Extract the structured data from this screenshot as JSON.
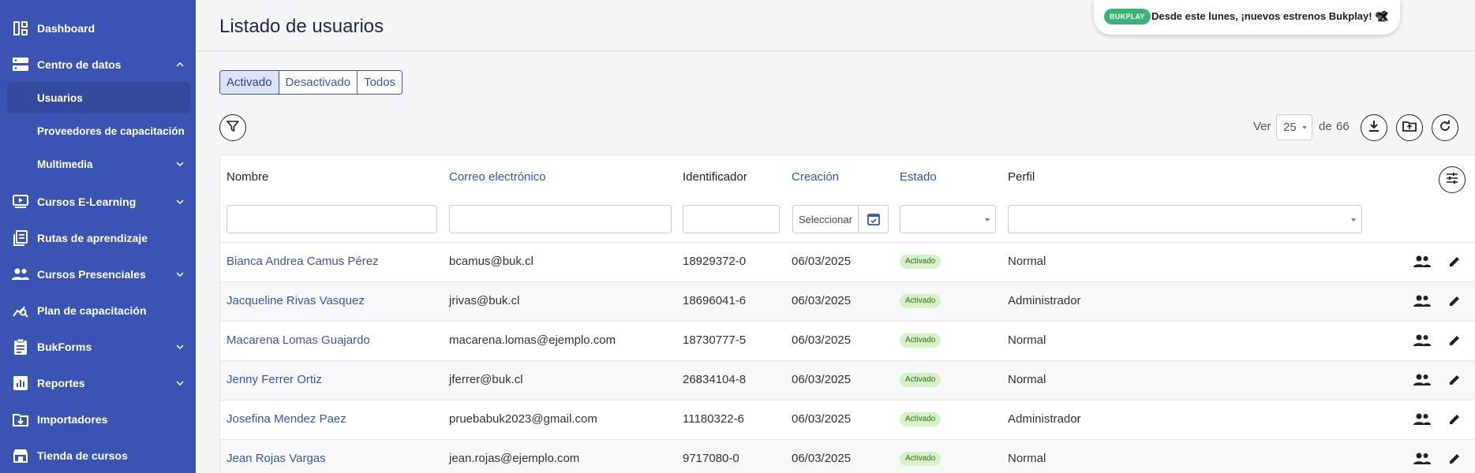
{
  "sidebar": {
    "items": [
      {
        "label": "Dashboard",
        "icon": "dashboard-icon"
      },
      {
        "label": "Centro de datos",
        "icon": "database-icon"
      },
      {
        "label": "Usuarios"
      },
      {
        "label": "Proveedores de capacitación"
      },
      {
        "label": "Multimedia"
      },
      {
        "label": "Cursos E-Learning",
        "icon": "video-course-icon"
      },
      {
        "label": "Rutas de aprendizaje",
        "icon": "learning-path-icon"
      },
      {
        "label": "Cursos Presenciales",
        "icon": "people-icon"
      },
      {
        "label": "Plan de capacitación",
        "icon": "analytics-icon"
      },
      {
        "label": "BukForms",
        "icon": "clipboard-icon"
      },
      {
        "label": "Reportes",
        "icon": "report-icon"
      },
      {
        "label": "Importadores",
        "icon": "import-icon"
      },
      {
        "label": "Tienda de cursos",
        "icon": "store-icon"
      }
    ]
  },
  "header": {
    "title": "Listado de usuarios"
  },
  "toast": {
    "badge": "BUKPLAY",
    "message": "Desde este lunes, ¡nuevos estrenos Bukplay! 📽"
  },
  "tabs": [
    "Activado",
    "Desactivado",
    "Todos"
  ],
  "pagination": {
    "ver_label": "Ver",
    "per_page": "25",
    "de_label": "de",
    "total": "66"
  },
  "table": {
    "columns": {
      "nombre": "Nombre",
      "correo": "Correo electrónico",
      "identificador": "Identificador",
      "creacion": "Creación",
      "estado": "Estado",
      "perfil": "Perfil"
    },
    "date_placeholder": "Seleccionar",
    "rows": [
      {
        "nombre": "Bianca Andrea Camus Pérez",
        "correo": "bcamus@buk.cl",
        "id": "18929372-0",
        "creacion": "06/03/2025",
        "estado": "Activado",
        "perfil": "Normal"
      },
      {
        "nombre": "Jacqueline Rivas Vasquez",
        "correo": "jrivas@buk.cl",
        "id": "18696041-6",
        "creacion": "06/03/2025",
        "estado": "Activado",
        "perfil": "Administrador"
      },
      {
        "nombre": "Macarena Lomas Guajardo",
        "correo": "macarena.lomas@ejemplo.com",
        "id": "18730777-5",
        "creacion": "06/03/2025",
        "estado": "Activado",
        "perfil": "Normal"
      },
      {
        "nombre": "Jenny Ferrer Ortiz",
        "correo": "jferrer@buk.cl",
        "id": "26834104-8",
        "creacion": "06/03/2025",
        "estado": "Activado",
        "perfil": "Normal"
      },
      {
        "nombre": "Josefina Mendez Paez",
        "correo": "pruebabuk2023@gmail.com",
        "id": "11180322-6",
        "creacion": "06/03/2025",
        "estado": "Activado",
        "perfil": "Administrador"
      },
      {
        "nombre": "Jean Rojas Vargas",
        "correo": "jean.rojas@ejemplo.com",
        "id": "9717080-0",
        "creacion": "06/03/2025",
        "estado": "Activado",
        "perfil": "Normal"
      }
    ]
  },
  "colors": {
    "sidebar_bg": "#3a54b4",
    "accent": "#3a54b4",
    "status_green": "#d6f1c8",
    "toast_badge": "#39b577"
  }
}
